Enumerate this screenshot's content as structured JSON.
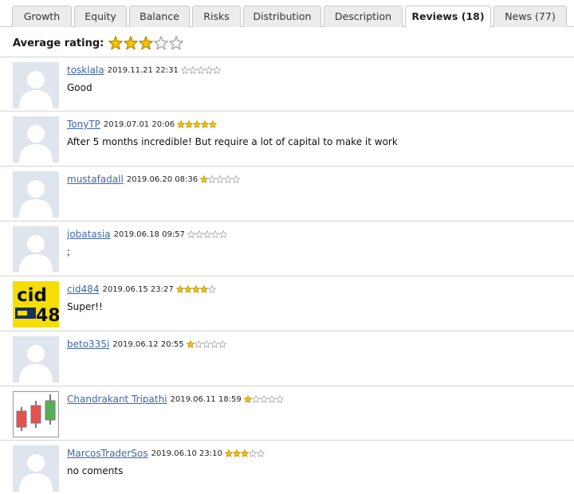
{
  "tabs": [
    {
      "label": "Growth"
    },
    {
      "label": "Equity"
    },
    {
      "label": "Balance"
    },
    {
      "label": "Risks"
    },
    {
      "label": "Distribution"
    },
    {
      "label": "Description"
    },
    {
      "label": "Reviews (18)",
      "active": true
    },
    {
      "label": "News (77)"
    }
  ],
  "average": {
    "label": "Average rating:",
    "rating": 3,
    "max": 5
  },
  "colors": {
    "star_fill": "#f6c400",
    "star_empty": "#ffffff",
    "star_outline": "#a0a0a0",
    "link": "#3f67a8"
  },
  "reviews": [
    {
      "author": "tosklala",
      "date": "2019.11.21 22:31",
      "rating": 0,
      "text": "Good",
      "avatar": "default-avatar"
    },
    {
      "author": "TonyTP",
      "date": "2019.07.01 20:06",
      "rating": 5,
      "text": "After 5 months incredible! But require a lot of capital to make it work",
      "avatar": "default-avatar"
    },
    {
      "author": "mustafadall",
      "date": "2019.06.20 08:36",
      "rating": 1,
      "text": "",
      "avatar": "default-avatar"
    },
    {
      "author": "jobatasia",
      "date": "2019.06.18 09:57",
      "rating": 0,
      "text": ";",
      "avatar": "default-avatar"
    },
    {
      "author": "cid484",
      "date": "2019.06.15 23:27",
      "rating": 4,
      "text": "Super!!",
      "avatar": "cid-logo",
      "avatar_text": [
        "cid",
        "48"
      ]
    },
    {
      "author": "beto335i",
      "date": "2019.06.12 20:55",
      "rating": 1,
      "text": "",
      "avatar": "default-avatar"
    },
    {
      "author": "Chandrakant Tripathi",
      "date": "2019.06.11 18:59",
      "rating": 1,
      "text": "",
      "avatar": "candlestick-avatar"
    },
    {
      "author": "MarcosTraderSos",
      "date": "2019.06.10 23:10",
      "rating": 3,
      "text": "no coments",
      "avatar": "default-avatar"
    }
  ]
}
